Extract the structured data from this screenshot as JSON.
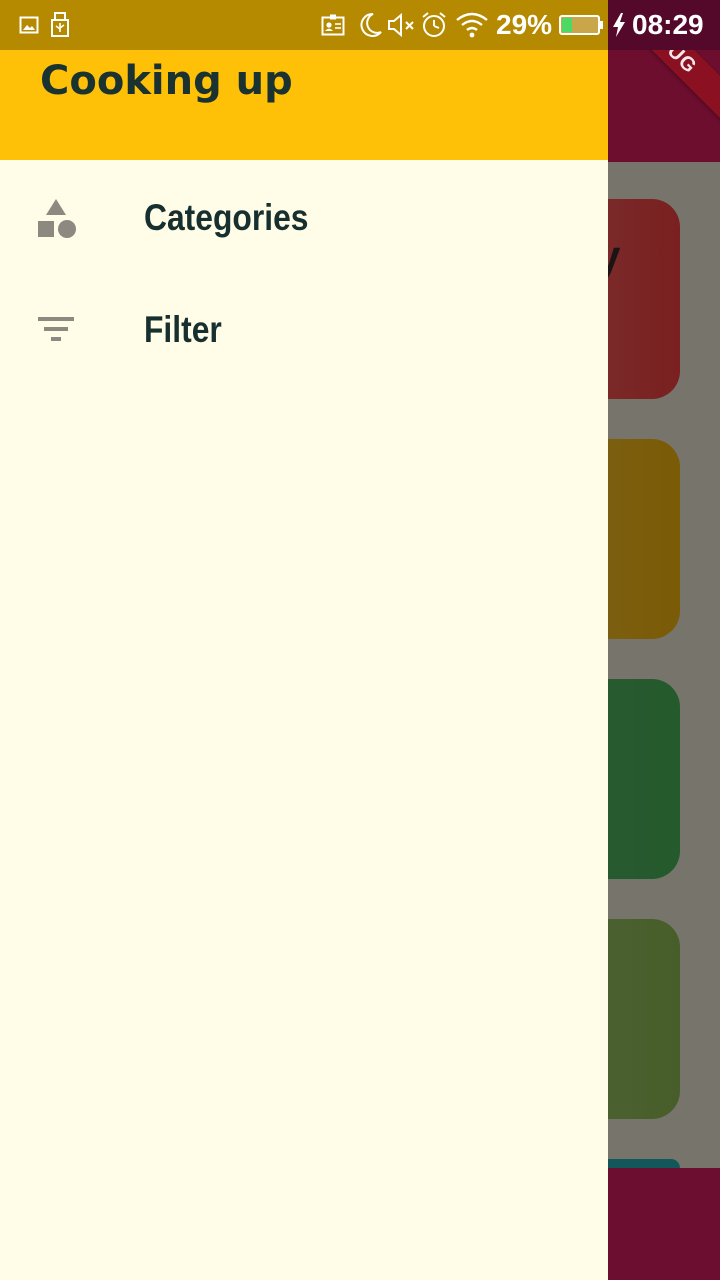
{
  "status_bar": {
    "battery_percent_text": "29%",
    "battery_level": 0.29,
    "time": "08:29",
    "icons": [
      "image-icon",
      "usb-icon",
      "contact-card-icon",
      "moon-icon",
      "mute-icon",
      "alarm-icon",
      "wifi-icon",
      "battery-icon",
      "charging-icon"
    ]
  },
  "debug_banner": {
    "label": "DEBUG"
  },
  "drawer": {
    "header_title": "Cooking up",
    "items": [
      {
        "label": "Categories",
        "icon": "category-icon"
      },
      {
        "label": "Filter",
        "icon": "filter-icon"
      }
    ]
  },
  "background_app": {
    "card_glyph": "y"
  },
  "colors": {
    "drawer_header": "#ffc107",
    "drawer_background": "#fffde7",
    "app_primary": "#6d0e2f",
    "text_dark": "#17302f",
    "icon_grey": "#8c8a80",
    "battery_fill": "#4cd964"
  }
}
